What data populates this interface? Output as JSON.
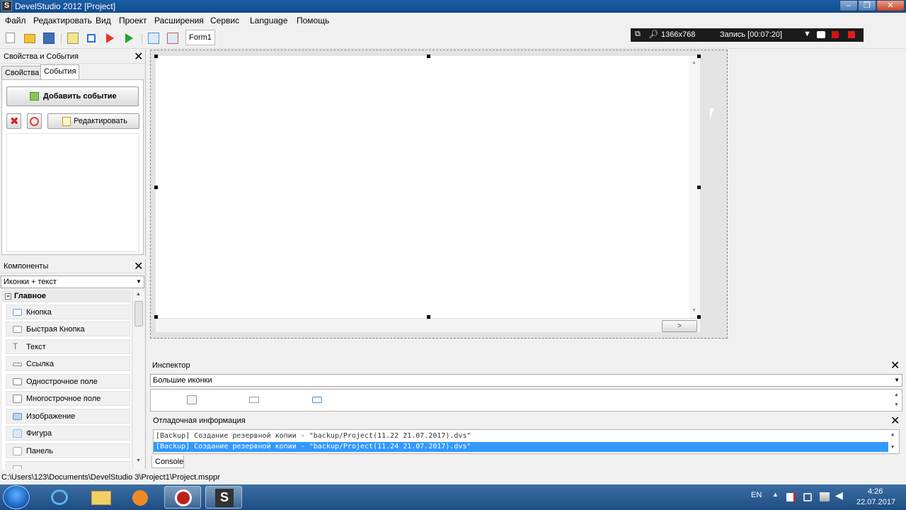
{
  "window": {
    "title": "DevelStudio 2012 [Project]",
    "icon_glyph": "S",
    "minimize_glyph": "–",
    "maximize_glyph": "❐",
    "close_glyph": "✕"
  },
  "menu": [
    "Файл",
    "Редактировать",
    "Вид",
    "Проект",
    "Расширения",
    "Сервис",
    "Language",
    "Помощь"
  ],
  "toolbar": {
    "icons": [
      "new-file-icon",
      "open-folder-icon",
      "save-icon",
      "build-icon",
      "stop-icon",
      "run-red-icon",
      "run-green-icon",
      "add-form-icon",
      "delete-form-icon"
    ],
    "form_tab": "Form1"
  },
  "recorder": {
    "resolution": "1366x768",
    "recording": "Запись [00:07:20]"
  },
  "properties_panel": {
    "title": "Свойства и События",
    "tabs": [
      "Свойства",
      "События"
    ],
    "active_tab": "События",
    "add_event": "Добавить событие",
    "edit": "Редактировать"
  },
  "components_panel": {
    "title": "Компоненты",
    "view_mode": "Иконки + текст",
    "group": "Главное",
    "items": [
      "Кнопка",
      "Быстрая Кнопка",
      "Текст",
      "Ссылка",
      "Однострочное поле",
      "Многострочное поле",
      "Изображение",
      "Фигура",
      "Панель"
    ]
  },
  "design": {
    "hscroll_arrow": ">"
  },
  "inspector": {
    "title": "Инспектор",
    "view_mode": "Большие иконки"
  },
  "debug": {
    "title": "Отладочная информация",
    "lines": [
      "[Backup] Создание резервной копии - \"backup/Project(11.22 21.07.2017).dvs\"",
      "[Backup] Создание резервной копии - \"backup/Project(11.24 21.07.2017).dvs\""
    ],
    "console_tab": "Console"
  },
  "status": {
    "path": "C:\\Users\\123\\Documents\\DevelStudio 3\\Project1\\Project.msppr"
  },
  "taskbar": {
    "lang": "EN",
    "time": "4:26",
    "date": "22.07.2017",
    "app_glyph": "S"
  },
  "colors": {
    "titlebar": "#1c5ea6",
    "selection": "#3399ff",
    "taskbar": "#2a5c93"
  }
}
